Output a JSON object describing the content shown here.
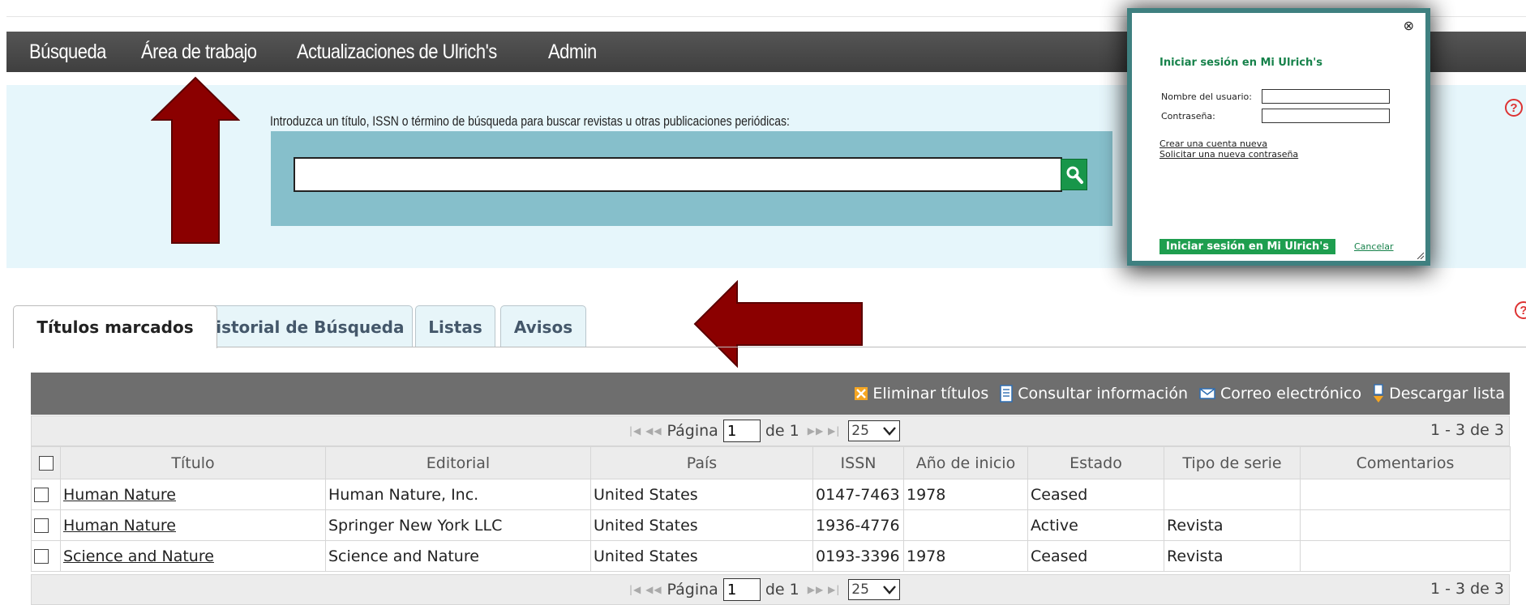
{
  "nav": {
    "items": [
      {
        "label": "Búsqueda"
      },
      {
        "label": "Área de trabajo"
      },
      {
        "label": "Actualizaciones de Ulrich's"
      },
      {
        "label": "Admin"
      }
    ]
  },
  "search": {
    "label": "Introduzca un título, ISSN o término de búsqueda para buscar revistas u otras publicaciones periódicas:",
    "value": "",
    "button_icon": "search-icon"
  },
  "help_icon": "?",
  "tabs": [
    {
      "label": "Títulos marcados",
      "active": true
    },
    {
      "label": "Historial de Búsqueda",
      "active": false
    },
    {
      "label": "Listas",
      "active": false
    },
    {
      "label": "Avisos",
      "active": false
    }
  ],
  "toolbar": {
    "delete_label": "Eliminar títulos",
    "info_label": "Consultar información",
    "email_label": "Correo electrónico",
    "download_label": "Descargar lista"
  },
  "pager": {
    "page_label": "Página",
    "page_value": "1",
    "of_label": "de 1",
    "per_page": "25",
    "count": "1 - 3 de 3"
  },
  "table": {
    "headers": [
      "Título",
      "Editorial",
      "País",
      "ISSN",
      "Año de inicio",
      "Estado",
      "Tipo de serie",
      "Comentarios"
    ],
    "rows": [
      {
        "title": "Human Nature",
        "publisher": "Human Nature, Inc.",
        "country": "United States",
        "issn": "0147-7463",
        "start_year": "1978",
        "status": "Ceased",
        "series_type": "",
        "comments": ""
      },
      {
        "title": "Human Nature",
        "publisher": "Springer New York LLC",
        "country": "United States",
        "issn": "1936-4776",
        "start_year": "",
        "status": "Active",
        "series_type": "Revista",
        "comments": ""
      },
      {
        "title": "Science and Nature",
        "publisher": "Science and Nature",
        "country": "United States",
        "issn": "0193-3396",
        "start_year": "1978",
        "status": "Ceased",
        "series_type": "Revista",
        "comments": ""
      }
    ]
  },
  "login": {
    "title": "Iniciar sesión en Mi Ulrich's",
    "username_label": "Nombre del usuario:",
    "username_value": "",
    "password_label": "Contraseña:",
    "password_value": "",
    "create_account": "Crear una cuenta nueva",
    "new_password": "Solicitar una nueva contraseña",
    "submit_label": "Iniciar sesión en Mi Ulrich's",
    "cancel_label": "Cancelar",
    "close_icon": "⊗"
  },
  "colors": {
    "navbar": "#4a4a4a",
    "search_band": "#e6f6fb",
    "search_box": "#86bfcb",
    "arrow": "#8b0000",
    "login_border": "#3f8080",
    "login_accent": "#17824b"
  }
}
